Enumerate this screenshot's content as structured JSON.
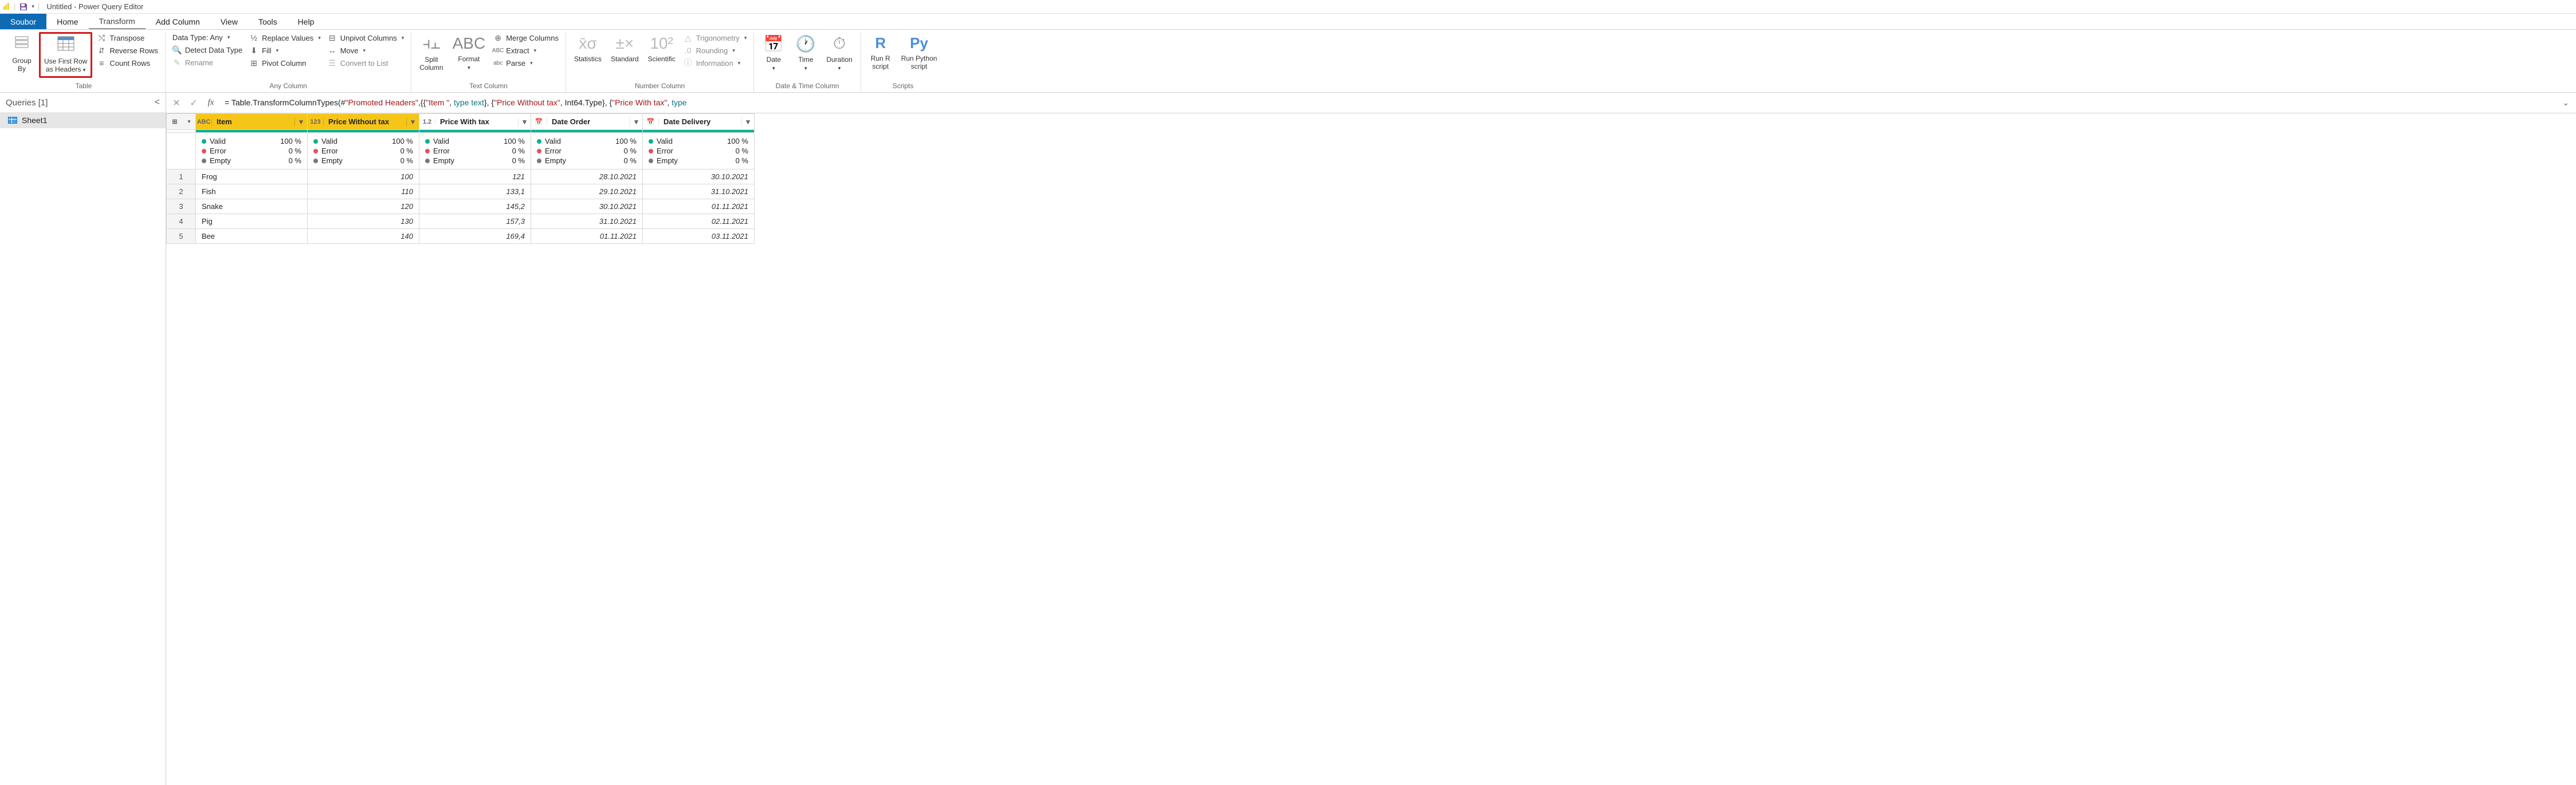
{
  "titlebar": {
    "title": "Untitled - Power Query Editor"
  },
  "menu": {
    "file": "Soubor",
    "tabs": [
      "Home",
      "Transform",
      "Add Column",
      "View",
      "Tools",
      "Help"
    ],
    "active": "Transform"
  },
  "ribbon": {
    "table": {
      "group_by": "Group\nBy",
      "use_first_row": "Use First Row\nas Headers",
      "transpose": "Transpose",
      "reverse_rows": "Reverse Rows",
      "count_rows": "Count Rows",
      "label": "Table"
    },
    "any_column": {
      "data_type": "Data Type: Any",
      "detect": "Detect Data Type",
      "rename": "Rename",
      "replace": "Replace Values",
      "fill": "Fill",
      "pivot": "Pivot Column",
      "unpivot": "Unpivot Columns",
      "move": "Move",
      "convert": "Convert to List",
      "label": "Any Column"
    },
    "text_column": {
      "split": "Split\nColumn",
      "format": "Format",
      "merge": "Merge Columns",
      "extract": "Extract",
      "parse": "Parse",
      "label": "Text Column"
    },
    "number_column": {
      "statistics": "Statistics",
      "standard": "Standard",
      "scientific": "Scientific",
      "trig": "Trigonometry",
      "rounding": "Rounding",
      "info": "Information",
      "label": "Number Column"
    },
    "datetime": {
      "date": "Date",
      "time": "Time",
      "duration": "Duration",
      "label": "Date & Time Column"
    },
    "scripts": {
      "r": "Run R\nscript",
      "py": "Run Python\nscript",
      "label": "Scripts"
    }
  },
  "queries": {
    "header": "Queries [1]",
    "items": [
      "Sheet1"
    ]
  },
  "formula": {
    "prefix": "= Table.TransformColumnTypes(#",
    "s1": "\"Promoted Headers\"",
    "mid1": ",{{",
    "s2": "\"Item \"",
    "mid2": ", ",
    "t1": "type text",
    "mid3": "}, {",
    "s3": "\"Price Without tax\"",
    "mid4": ", Int64.Type}, {",
    "s4": "\"Price With tax\"",
    "mid5": ", ",
    "t2": "type"
  },
  "columns": [
    {
      "type": "ABC",
      "name": "Item",
      "selected": true
    },
    {
      "type": "123",
      "name": "Price Without tax",
      "selected": true
    },
    {
      "type": "1.2",
      "name": "Price With tax",
      "selected": false
    },
    {
      "type": "date",
      "name": "Date Order",
      "selected": false
    },
    {
      "type": "date",
      "name": "Date Delivery",
      "selected": false
    }
  ],
  "stats": {
    "valid_label": "Valid",
    "error_label": "Error",
    "empty_label": "Empty",
    "valid_pct": "100 %",
    "error_pct": "0 %",
    "empty_pct": "0 %"
  },
  "rows": [
    {
      "n": "1",
      "item": "Frog",
      "pw": "100",
      "pt": "121",
      "do": "28.10.2021",
      "dd": "30.10.2021"
    },
    {
      "n": "2",
      "item": "Fish",
      "pw": "110",
      "pt": "133,1",
      "do": "29.10.2021",
      "dd": "31.10.2021"
    },
    {
      "n": "3",
      "item": "Snake",
      "pw": "120",
      "pt": "145,2",
      "do": "30.10.2021",
      "dd": "01.11.2021"
    },
    {
      "n": "4",
      "item": "Pig",
      "pw": "130",
      "pt": "157,3",
      "do": "31.10.2021",
      "dd": "02.11.2021"
    },
    {
      "n": "5",
      "item": "Bee",
      "pw": "140",
      "pt": "169,4",
      "do": "01.11.2021",
      "dd": "03.11.2021"
    }
  ]
}
